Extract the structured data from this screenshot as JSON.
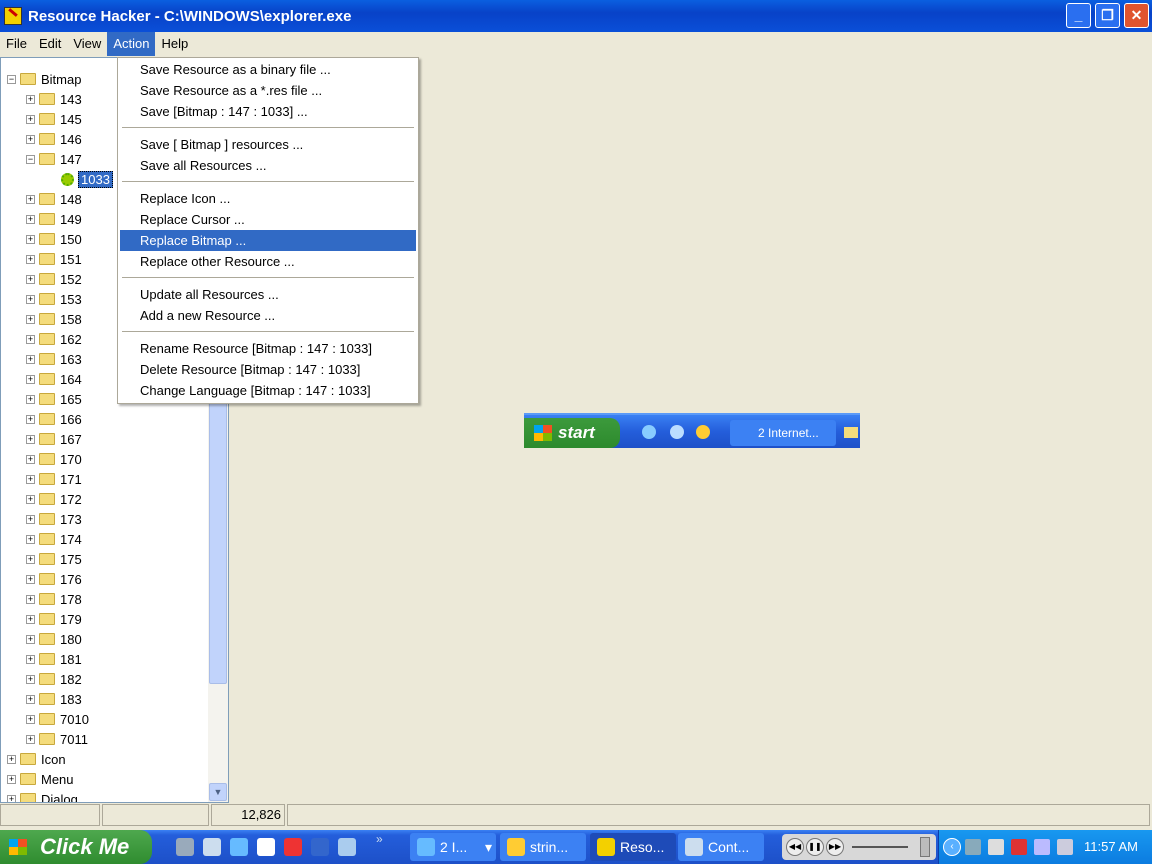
{
  "window": {
    "title": "Resource Hacker  -  C:\\WINDOWS\\explorer.exe",
    "buttons": [
      "minimize",
      "maximize",
      "close"
    ]
  },
  "menubar": [
    {
      "label": "File"
    },
    {
      "label": "Edit"
    },
    {
      "label": "View"
    },
    {
      "label": "Action",
      "active": true
    },
    {
      "label": "Help"
    }
  ],
  "tree": {
    "root": "Bitmap",
    "children": [
      "143",
      "145",
      "146",
      "147",
      "148",
      "149",
      "150",
      "151",
      "152",
      "153",
      "158",
      "162",
      "163",
      "164",
      "165",
      "166",
      "167",
      "170",
      "171",
      "172",
      "173",
      "174",
      "175",
      "176",
      "178",
      "179",
      "180",
      "181",
      "182",
      "183",
      "7010",
      "7011"
    ],
    "expanded": "147",
    "selected_leaf": "1033",
    "other_roots": [
      "Icon",
      "Menu",
      "Dialog"
    ]
  },
  "action_menu": {
    "groups": [
      [
        "Save Resource as a binary file ...",
        "Save Resource as a *.res file ...",
        "Save [Bitmap : 147 : 1033] ..."
      ],
      [
        "Save [ Bitmap ] resources ...",
        "Save all Resources ..."
      ],
      [
        "Replace Icon ...",
        "Replace Cursor ...",
        "Replace Bitmap ...",
        "Replace other Resource ..."
      ],
      [
        "Update all Resources ...",
        "Add a new Resource ..."
      ],
      [
        "Rename Resource [Bitmap : 147 : 1033]",
        "Delete Resource [Bitmap : 147 : 1033]",
        "Change Language [Bitmap : 147 : 1033]"
      ]
    ],
    "highlighted": "Replace Bitmap ..."
  },
  "preview": {
    "start_label": "start",
    "task_label": "2 Internet..."
  },
  "statusbar": {
    "panels": [
      "",
      "",
      "12,826",
      ""
    ]
  },
  "taskbar": {
    "start_label": "Click Me",
    "quick_launch": [
      "show-desktop-icon",
      "notepad-icon",
      "ie-icon",
      "paint-icon",
      "aim-icon",
      "word-icon",
      "itunes-icon"
    ],
    "chevron": "»",
    "tasks": [
      {
        "label": "2 I...",
        "icon": "ie-icon"
      },
      {
        "label": "strin...",
        "icon": "resource-icon"
      },
      {
        "label": "Reso...",
        "icon": "reshacker-icon",
        "active": true
      },
      {
        "label": "Cont...",
        "icon": "control-icon"
      }
    ],
    "tray_icons": [
      "network-icon",
      "msn-icon",
      "security-icon",
      "mail-icon",
      "antivirus-icon"
    ],
    "clock": "11:57 AM"
  }
}
